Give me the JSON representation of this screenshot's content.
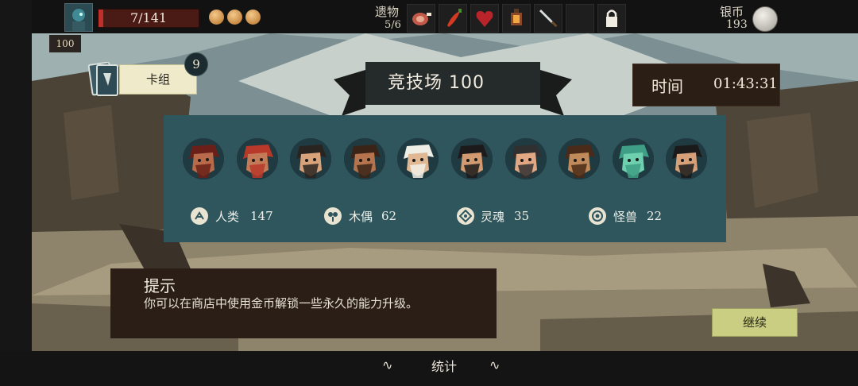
{
  "top_bar": {
    "hp": {
      "current": 7,
      "max": 141,
      "text": "7/141",
      "fraction": 0.05
    },
    "gold_orbs": 3,
    "relics": {
      "label": "遗物",
      "count": "5/6",
      "slots": [
        "meat-relic-icon",
        "chili-relic-icon",
        "heart-relic-icon",
        "lantern-relic-icon",
        "sword-relic-icon",
        "empty-slot",
        "lock-icon"
      ]
    },
    "silver": {
      "label": "银币",
      "count": "193"
    }
  },
  "floor": {
    "value": "100"
  },
  "deck": {
    "label": "卡组",
    "count": "9"
  },
  "arena": {
    "title": "竞技场 100"
  },
  "timer": {
    "label": "时间",
    "value": "01:43:31"
  },
  "opponents": [
    "red-eyepatch-pirate-avatar",
    "red-hair-captain-avatar",
    "bearded-viking-avatar",
    "hat-pirate-avatar",
    "horned-viking-avatar",
    "long-hair-pirate-avatar",
    "tricorn-captain-avatar",
    "bearded-brute-avatar",
    "ghost-avatar",
    "scarf-rogue-avatar"
  ],
  "stats": [
    {
      "icon": "human-icon",
      "label": "人类",
      "value": "147"
    },
    {
      "icon": "puppet-icon",
      "label": "木偶",
      "value": "62"
    },
    {
      "icon": "soul-icon",
      "label": "灵魂",
      "value": "35"
    },
    {
      "icon": "beast-icon",
      "label": "怪兽",
      "value": "22"
    }
  ],
  "hint": {
    "title": "提示",
    "text": "你可以在商店中使用金币解锁一些永久的能力升级。"
  },
  "continue_label": "继续",
  "bottom": {
    "stats_tab": "统计"
  },
  "colors": {
    "panel": "#2f555d",
    "hp": "#c0302a",
    "continue": "#c9ce82",
    "deck": "#efeac9"
  }
}
